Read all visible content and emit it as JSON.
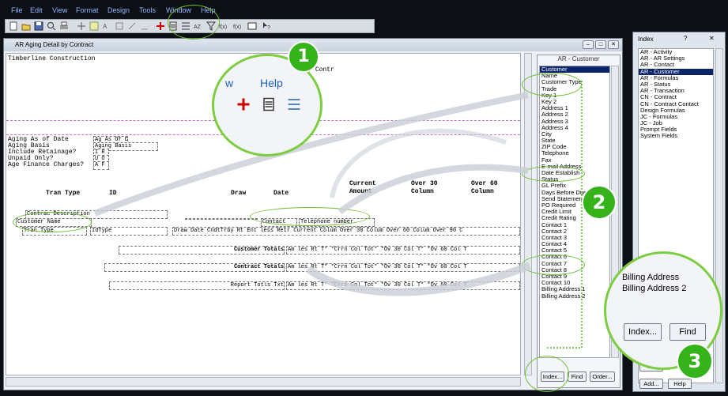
{
  "menu": [
    "File",
    "Edit",
    "View",
    "Format",
    "Design",
    "Tools",
    "Window",
    "Help"
  ],
  "report_window": {
    "title": "AR Aging Detail by Contract",
    "company": "Timberline Construction",
    "report_heading": "AR Aging Det by Contr",
    "param_labels": [
      "Aging As of Date",
      "Aging Basis",
      "Include Retainage?",
      "Unpaid Only?",
      "Age Finance Charges?"
    ],
    "param_fields": [
      "Ag As Of D",
      "Aging Basis",
      "I R",
      "U O",
      "A F"
    ],
    "col_headers": {
      "tran_type": "Tran Type",
      "id": "ID",
      "draw": "Draw",
      "date": "Date",
      "current": "Current",
      "current2": "Amount",
      "over30": "Over 30",
      "over30b": "Column",
      "over60": "Over 60",
      "over60b": "Column"
    },
    "fields": {
      "contract_description": "Contrac Description",
      "customer_name": "Customer Name",
      "contact": "Contact",
      "telephone": "Telephone number",
      "tran_type": "Tran Type",
      "id_type": "IdType",
      "detail_row": "Draw Date CndtTrby Rt Ent less Retr Current Colum Over 30 Colum Over 60 Colum Over 90 C",
      "customer_totals": "Customer Totals",
      "customer_totals_row": "Am les Rt T* *Crrn Col Tot* *Ov 30 Col T* *Ov 60 Col T",
      "contract_totals": "Contract Totals",
      "contract_totals_row": "Am les Rt T* *Crrn Col Tot* *Ov 30 Col T* *Ov 60 Col T",
      "report_totals": "Report Totls Txt",
      "report_totals_row": "Am les Rt T* *Crrn Col Tot* *Ov 30 Col T* *Ov 60 Col T"
    }
  },
  "field_panel": {
    "title": "AR - Customer",
    "items": [
      "Customer",
      "Name",
      "Customer Type",
      "Trade",
      "Key 1",
      "Key 2",
      "Address 1",
      "Address 2",
      "Address 3",
      "Address 4",
      "City",
      "State",
      "ZIP Code",
      "Telephone",
      "Fax",
      "E-mail Address",
      "Date Establish",
      "Status",
      "GL Prefix",
      "Days Before Due",
      "Send Statement",
      "PO Required",
      "Credit Limit",
      "Credit Rating",
      "Contact 1",
      "Contact 2",
      "Contact 3",
      "Contact 4",
      "Contact 5",
      "Contact 6",
      "Contact 7",
      "Contact 8",
      "Contact 9",
      "Contact 10",
      "Billing Address 1",
      "Billing Address 2"
    ],
    "selected": "Customer",
    "buttons": [
      "Index...",
      "Find",
      "Order..."
    ]
  },
  "index_window": {
    "title": "Index",
    "items": [
      "AR - Activity",
      "AR - AR Settings",
      "AR - Contact",
      "AR - Customer",
      "AR - Formulas",
      "AR - Status",
      "AR - Transaction",
      "CN - Contract",
      "CN - Contract Contact",
      "Design Formulas",
      "JC - Formulas",
      "JC - Job",
      "Prompt Fields",
      "System Fields"
    ],
    "selected": "AR - Customer",
    "buttons": [
      "OK",
      "Add...",
      "Help"
    ]
  },
  "callouts": {
    "badge1": "1",
    "badge2": "2",
    "badge3": "3",
    "zoom1_menu": [
      "w",
      "Help"
    ],
    "zoom3_items": [
      "Billing Address",
      "Billing Address 2"
    ],
    "zoom3_buttons": [
      "Index...",
      "Find"
    ]
  },
  "colors": {
    "accent_green": "#36b31a",
    "ring_green": "#7ccd3f",
    "selection": "#0a246a",
    "menu_text": "#8fb8ff"
  }
}
